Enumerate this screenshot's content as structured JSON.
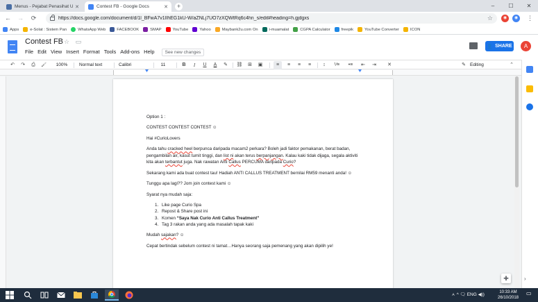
{
  "browser": {
    "tabs": [
      {
        "title": "Menus - Pejabat Penasihat Undang",
        "favicon_color": "#4a6fa5"
      },
      {
        "title": "Contest FB - Google Docs",
        "favicon_color": "#4285f4"
      }
    ],
    "new_tab_glyph": "+",
    "window_controls": [
      "–",
      "☐",
      "✕"
    ],
    "nav": {
      "back": "←",
      "forward": "→",
      "reload": "⟳"
    },
    "url": "https://docs.google.com/document/d/1l_BFwA7v1lIhEG1kU-W/aZNLj7UO7zXQWtRq6c4hn_s/edit#heading=h.gjdgxs",
    "star_glyph": "☆",
    "menu_glyph": "⋮"
  },
  "bookmarks": [
    {
      "label": "Apps",
      "color": "#4285f4"
    },
    {
      "label": "e-Solat : Sistem Pan",
      "color": "#f4b400"
    },
    {
      "label": "WhatsApp Web",
      "color": "#25d366"
    },
    {
      "label": "FACEBOOK",
      "color": "#3b5998"
    },
    {
      "label": "SMAP",
      "color": "#7b1fa2"
    },
    {
      "label": "YouTube",
      "color": "#ff0000"
    },
    {
      "label": "Yahoo",
      "color": "#6001d2"
    },
    {
      "label": "Maybank2u.com On",
      "color": "#f9a825"
    },
    {
      "label": "i-muamalat",
      "color": "#00695c"
    },
    {
      "label": "CGPA Calculator",
      "color": "#43a047"
    },
    {
      "label": "freepik",
      "color": "#1e88e5"
    },
    {
      "label": "YouTube Converter",
      "color": "#f4b400"
    },
    {
      "label": "ICON",
      "color": "#f4b400"
    }
  ],
  "docs": {
    "title": "Contest FB",
    "title_icons": "☆ ▭",
    "menu": [
      "File",
      "Edit",
      "View",
      "Insert",
      "Format",
      "Tools",
      "Add-ons",
      "Help"
    ],
    "last_edit": "See new changes",
    "share_label": "SHARE",
    "avatar_initial": "A"
  },
  "toolbar": {
    "undo": "↶",
    "redo": "↷",
    "print": "⎙",
    "paint": "🖌",
    "zoom": "100%",
    "style": "Normal text",
    "font": "Calibri",
    "size": "11",
    "bold": "B",
    "italic": "I",
    "underline": "U",
    "text_color": "A",
    "link": "⛓",
    "comment": "⊞",
    "image": "▣",
    "align_left": "≡",
    "align_center": "≡",
    "align_right": "≡",
    "justify": "≡",
    "line_spacing": "↕",
    "numbered": "⅟≡",
    "bulleted": "•≡",
    "outdent": "⇤",
    "indent": "⇥",
    "clear": "✕",
    "mode": "Editing",
    "collapse": "⌃"
  },
  "document": {
    "option": "Option 1 :",
    "heading": "CONTEST CONTEST CONTEST ☺",
    "greeting": "Hai #CurioLovers",
    "p1": {
      "t1": "Anda tahu ",
      "w1": "cracked heel",
      "t2": " berpunca daripada macam2 perkara? Boleh jadi faktor pemakanan, berat badan, pengambilan air, kasut tumit tinggi, dan ",
      "w2": "list ni",
      "t3": " akan terus ",
      "w3": "berpanjangan",
      "t4": ". Kalau kaki tidak dijaga, segala aktiviti kita akan ",
      "w4": "terbantut",
      "t5": " juga. Nak rawatan Anti ",
      "w5": "Callus",
      "t6": " PERCUMA daripada ",
      "w6": "Curio",
      "t7": "?"
    },
    "p2": "Sekarang kami ada buat contest tau! Hadiah ANTI CALLUS TREATMENT bernilai RM59 menanti anda! ☺",
    "p3": "Tunggu apa lagi?? Jom join contest kami ☺",
    "p4": "Syarat nya mudah saja:",
    "steps": [
      "Like page Curio Spa",
      "Repost & Share post ini",
      "Komen ",
      "Tag 3 rakan anda yang ada masalah tapak kaki"
    ],
    "step3_bold": "“Saya Nak Curio Anti Callus Treatment”",
    "p5": {
      "t1": "Mudah ",
      "w1": "sajakan",
      "t2": "? ☺"
    },
    "p6": "Cepat bertindak sebelum contest ni tamat…Hanya seorang saja pemenang yang akan dipilih ye!"
  },
  "side": {
    "explore_glyph": "✚",
    "arrow": "›"
  },
  "taskbar": {
    "time": "10:33 AM",
    "date": "26/10/2018",
    "tray": "ㅅ ^ 🗨 ENG ◀))",
    "notif": "▭"
  }
}
